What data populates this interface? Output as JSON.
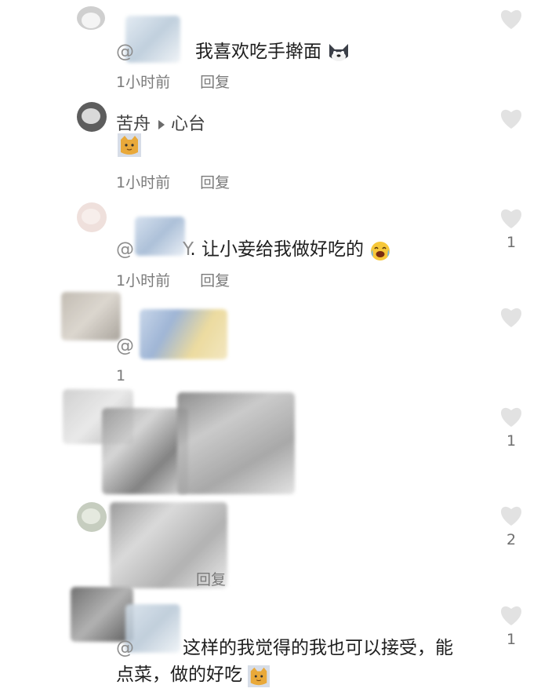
{
  "comments": [
    {
      "mention": "@",
      "text": "我喜欢吃手擀面",
      "time": "1小时前",
      "reply": "回复"
    },
    {
      "author": "苦舟",
      "reply_to": "心台",
      "time": "1小时前",
      "reply": "回复"
    },
    {
      "mention": "@",
      "mention_suffix": "Y",
      "text": ". 让小妾给我做好吃的",
      "time": "1小时前",
      "reply": "回复"
    },
    {
      "mention": "@",
      "time": "1",
      "reply": ""
    },
    {
      "reply": "回复"
    },
    {
      "mention": "@",
      "text_line1": "这样的我觉得的我也可以接受，能",
      "text_line2": "点菜，做的好吃"
    }
  ],
  "likes": [
    {
      "count": ""
    },
    {
      "count": ""
    },
    {
      "count": "1"
    },
    {
      "count": ""
    },
    {
      "count": "1"
    },
    {
      "count": "2"
    },
    {
      "count": "1"
    }
  ],
  "icons": {
    "heart": "heart-icon",
    "cat_emoji": "cat-face-emoji",
    "doge_emoji": "dog-face-emoji",
    "crying_emoji": "crying-laughing-emoji"
  },
  "colors": {
    "heart": "#e2e2e2",
    "meta": "#7a7a7a",
    "text": "#1e1e1e"
  }
}
